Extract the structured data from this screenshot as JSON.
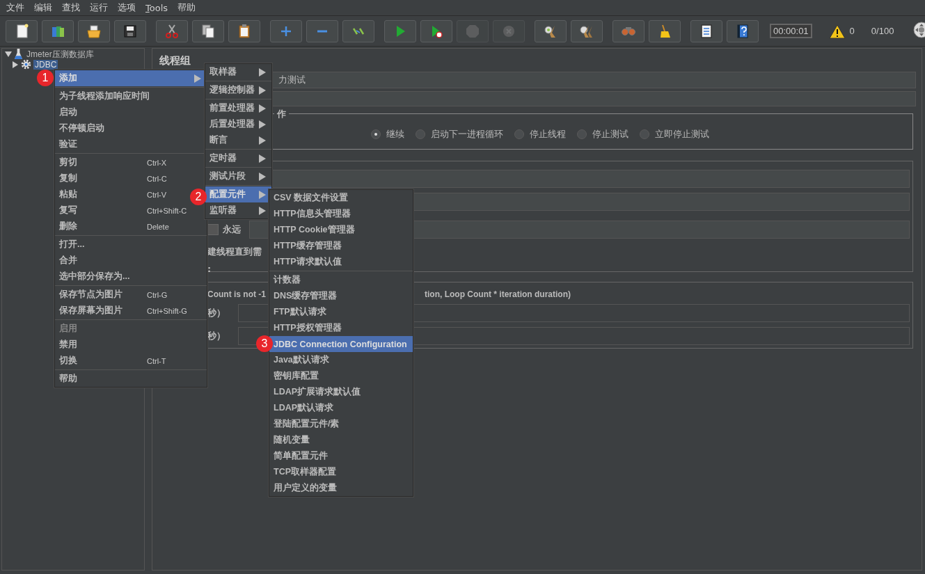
{
  "menubar": {
    "items": [
      {
        "label": "文件",
        "mnemonic": false
      },
      {
        "label": "编辑",
        "mnemonic": false
      },
      {
        "label": "查找",
        "mnemonic": false
      },
      {
        "label": "运行",
        "mnemonic": false
      },
      {
        "label": "选项",
        "mnemonic": false
      },
      {
        "label": "Tools",
        "mnemonic": true
      },
      {
        "label": "帮助",
        "mnemonic": false
      }
    ]
  },
  "toolbar": {
    "groups": [
      [
        {
          "disabled": false
        },
        {
          "disabled": false
        },
        {
          "disabled": false
        },
        {
          "disabled": false
        }
      ],
      [
        {
          "disabled": false
        },
        {
          "disabled": false
        },
        {
          "disabled": false
        }
      ],
      [
        {
          "disabled": false
        },
        {
          "disabled": false
        },
        {
          "disabled": false
        }
      ],
      [
        {
          "disabled": false
        },
        {
          "disabled": false
        },
        {
          "disabled": true
        },
        {
          "disabled": true
        }
      ],
      [
        {
          "disabled": false
        },
        {
          "disabled": false
        }
      ],
      [
        {
          "disabled": false
        },
        {
          "disabled": false
        }
      ],
      [
        {
          "disabled": false
        },
        {
          "disabled": false
        }
      ]
    ],
    "timer": "00:00:01",
    "warnings": "0",
    "threads": "0/100"
  },
  "tree": {
    "label": "Jmeter压测数据库",
    "expanded": true,
    "children": [
      {
        "label": "JDBC",
        "expanded": false,
        "selected": true
      }
    ]
  },
  "thread_group": {
    "title": "线程组",
    "name_value": "力测试",
    "error_action_legend": "作",
    "radios": [
      {
        "label": "继续",
        "selected": true
      },
      {
        "label": "启动下一进程循环",
        "selected": false
      },
      {
        "label": "停止线程",
        "selected": false
      },
      {
        "label": "停止测试",
        "selected": false
      },
      {
        "label": "立即停止测试",
        "selected": false
      }
    ],
    "loop": {
      "label": "永远",
      "checked": false
    },
    "delay_label": "建线程直到需",
    "colon": ":",
    "scheduler": {
      "note_left": "Count is not -1",
      "note_right": "tion, Loop Count * iteration duration)",
      "labels": [
        "秒）",
        "秒）"
      ]
    }
  },
  "context_menu": {
    "items": [
      {
        "kind": "item",
        "label": "添加",
        "submenu": true,
        "selected": true,
        "disabled": false
      },
      {
        "kind": "separator"
      },
      {
        "kind": "item",
        "label": "为子线程添加响应时间",
        "submenu": false,
        "selected": false,
        "disabled": false
      },
      {
        "kind": "item",
        "label": "启动",
        "submenu": false,
        "selected": false,
        "disabled": false
      },
      {
        "kind": "item",
        "label": "不停顿启动",
        "submenu": false,
        "selected": false,
        "disabled": false
      },
      {
        "kind": "item",
        "label": "验证",
        "submenu": false,
        "selected": false,
        "disabled": false
      },
      {
        "kind": "separator"
      },
      {
        "kind": "item",
        "label": "剪切",
        "shortcut": "Ctrl-X",
        "submenu": false,
        "selected": false,
        "disabled": false
      },
      {
        "kind": "item",
        "label": "复制",
        "shortcut": "Ctrl-C",
        "submenu": false,
        "selected": false,
        "disabled": false
      },
      {
        "kind": "item",
        "label": "粘贴",
        "shortcut": "Ctrl-V",
        "submenu": false,
        "selected": false,
        "disabled": false
      },
      {
        "kind": "item",
        "label": "复写",
        "shortcut": "Ctrl+Shift-C",
        "submenu": false,
        "selected": false,
        "disabled": false
      },
      {
        "kind": "item",
        "label": "删除",
        "shortcut": "Delete",
        "submenu": false,
        "selected": false,
        "disabled": false
      },
      {
        "kind": "separator"
      },
      {
        "kind": "item",
        "label": "打开...",
        "submenu": false,
        "selected": false,
        "disabled": false
      },
      {
        "kind": "item",
        "label": "合并",
        "submenu": false,
        "selected": false,
        "disabled": false
      },
      {
        "kind": "item",
        "label": "选中部分保存为...",
        "submenu": false,
        "selected": false,
        "disabled": false
      },
      {
        "kind": "separator"
      },
      {
        "kind": "item",
        "label": "保存节点为图片",
        "shortcut": "Ctrl-G",
        "submenu": false,
        "selected": false,
        "disabled": false
      },
      {
        "kind": "item",
        "label": "保存屏幕为图片",
        "shortcut": "Ctrl+Shift-G",
        "submenu": false,
        "selected": false,
        "disabled": false
      },
      {
        "kind": "separator"
      },
      {
        "kind": "item",
        "label": "启用",
        "submenu": false,
        "selected": false,
        "disabled": true
      },
      {
        "kind": "item",
        "label": "禁用",
        "submenu": false,
        "selected": false,
        "disabled": false
      },
      {
        "kind": "item",
        "label": "切换",
        "shortcut": "Ctrl-T",
        "submenu": false,
        "selected": false,
        "disabled": false
      },
      {
        "kind": "separator"
      },
      {
        "kind": "item",
        "label": "帮助",
        "submenu": false,
        "selected": false,
        "disabled": false
      }
    ]
  },
  "add_menu": {
    "items": [
      {
        "kind": "item",
        "label": "取样器",
        "submenu": true,
        "selected": false
      },
      {
        "kind": "separator"
      },
      {
        "kind": "item",
        "label": "逻辑控制器",
        "submenu": true,
        "selected": false
      },
      {
        "kind": "separator"
      },
      {
        "kind": "item",
        "label": "前置处理器",
        "submenu": true,
        "selected": false
      },
      {
        "kind": "item",
        "label": "后置处理器",
        "submenu": true,
        "selected": false
      },
      {
        "kind": "item",
        "label": "断言",
        "submenu": true,
        "selected": false
      },
      {
        "kind": "separator"
      },
      {
        "kind": "item",
        "label": "定时器",
        "submenu": true,
        "selected": false
      },
      {
        "kind": "separator"
      },
      {
        "kind": "item",
        "label": "测试片段",
        "submenu": true,
        "selected": false
      },
      {
        "kind": "separator"
      },
      {
        "kind": "item",
        "label": "配置元件",
        "submenu": true,
        "selected": true
      },
      {
        "kind": "item",
        "label": "监听器",
        "submenu": true,
        "selected": false
      }
    ]
  },
  "config_menu": {
    "items": [
      {
        "kind": "item",
        "label": "CSV 数据文件设置",
        "selected": false
      },
      {
        "kind": "item",
        "label": "HTTP信息头管理器",
        "selected": false
      },
      {
        "kind": "item",
        "label": "HTTP Cookie管理器",
        "selected": false
      },
      {
        "kind": "item",
        "label": "HTTP缓存管理器",
        "selected": false
      },
      {
        "kind": "item",
        "label": "HTTP请求默认值",
        "selected": false
      },
      {
        "kind": "separator"
      },
      {
        "kind": "item",
        "label": "计数器",
        "selected": false
      },
      {
        "kind": "item",
        "label": "DNS缓存管理器",
        "selected": false
      },
      {
        "kind": "item",
        "label": "FTP默认请求",
        "selected": false
      },
      {
        "kind": "item",
        "label": "HTTP授权管理器",
        "selected": false
      },
      {
        "kind": "item",
        "label": "JDBC Connection Configuration",
        "selected": true
      },
      {
        "kind": "item",
        "label": "Java默认请求",
        "selected": false
      },
      {
        "kind": "item",
        "label": "密钥库配置",
        "selected": false
      },
      {
        "kind": "item",
        "label": "LDAP扩展请求默认值",
        "selected": false
      },
      {
        "kind": "item",
        "label": "LDAP默认请求",
        "selected": false
      },
      {
        "kind": "item",
        "label": "登陆配置元件/素",
        "selected": false
      },
      {
        "kind": "item",
        "label": "随机变量",
        "selected": false
      },
      {
        "kind": "item",
        "label": "简单配置元件",
        "selected": false
      },
      {
        "kind": "item",
        "label": "TCP取样器配置",
        "selected": false
      },
      {
        "kind": "item",
        "label": "用户定义的变量",
        "selected": false
      }
    ]
  },
  "step_markers": [
    "1",
    "2",
    "3"
  ]
}
